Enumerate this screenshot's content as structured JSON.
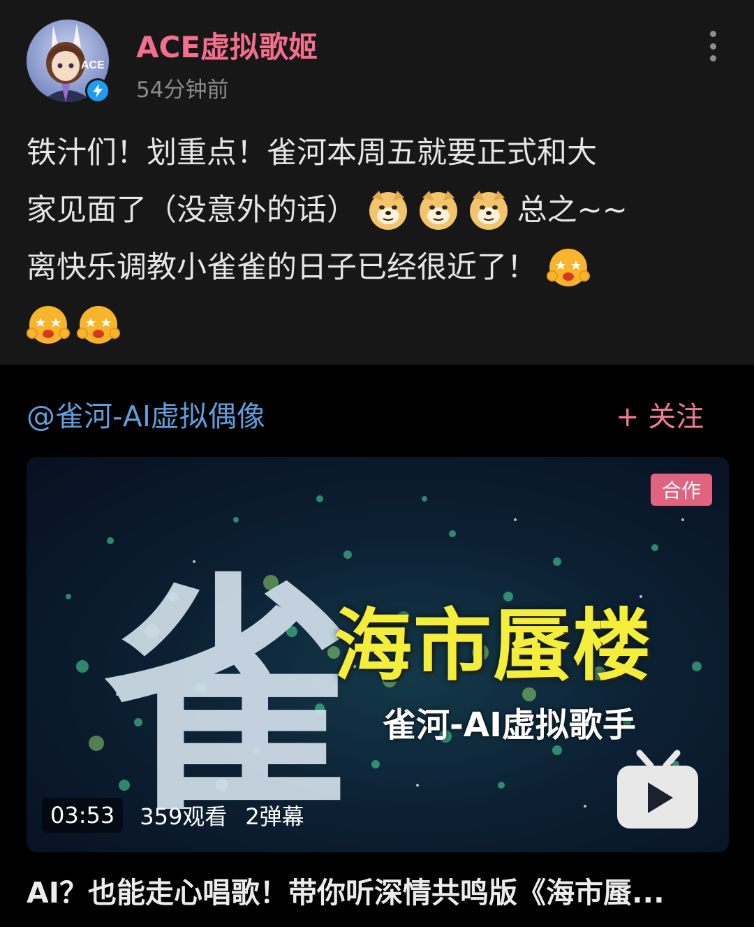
{
  "author": {
    "name": "ACE虚拟歌姬",
    "time": "54分钟前",
    "avatar_icon": "anime-avatar-icon",
    "verified_icon": "lightning-verified-icon",
    "name_color": "#f46e8e"
  },
  "post": {
    "line1": "铁汁们！划重点！雀河本周五就要正式和大",
    "line2": "家见面了（没意外的话）",
    "line2_tail": "总之~~",
    "line3": "离快乐调教小雀雀的日子已经很近了！",
    "emojis": [
      "doge-emoji",
      "doge-emoji",
      "doge-emoji",
      "starry-eyed-emoji",
      "starry-eyed-emoji",
      "starry-eyed-emoji"
    ]
  },
  "shared": {
    "mention": "@雀河-AI虚拟偶像",
    "follow_label": "+ 关注",
    "mention_color": "#5f9edc",
    "follow_color": "#f27a93"
  },
  "video": {
    "badge": "合作",
    "overlay_title": "海市蜃楼",
    "overlay_subtitle": "雀河-AI虚拟歌手",
    "calligraphy_char": "雀",
    "duration": "03:53",
    "views": "359观看",
    "danmaku": "2弹幕",
    "title": "AI？也能走心唱歌！带你听深情共鸣版《海市蜃...",
    "badge_color": "#e0647f",
    "overlay_title_color": "#f3ee3c"
  }
}
